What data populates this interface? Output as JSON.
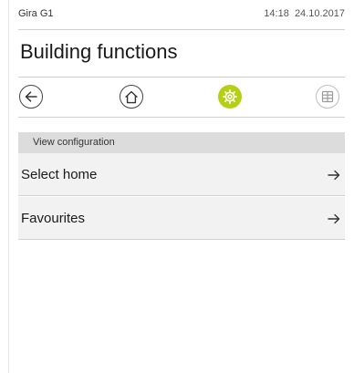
{
  "status_bar": {
    "device_name": "Gira G1",
    "time": "14:18",
    "date": "24.10.2017"
  },
  "header": {
    "title": "Building functions"
  },
  "nav": {
    "buttons": [
      {
        "icon": "back-arrow-icon",
        "active": false
      },
      {
        "icon": "home-icon",
        "active": false
      },
      {
        "icon": "gear-icon",
        "active": true
      },
      {
        "icon": "grid-icon",
        "active": false
      }
    ],
    "accent_color": "#b4cf14"
  },
  "section": {
    "title": "View configuration"
  },
  "list": {
    "items": [
      {
        "label": "Select home",
        "icon": "arrow-right-icon"
      },
      {
        "label": "Favourites",
        "icon": "arrow-right-icon"
      }
    ]
  }
}
